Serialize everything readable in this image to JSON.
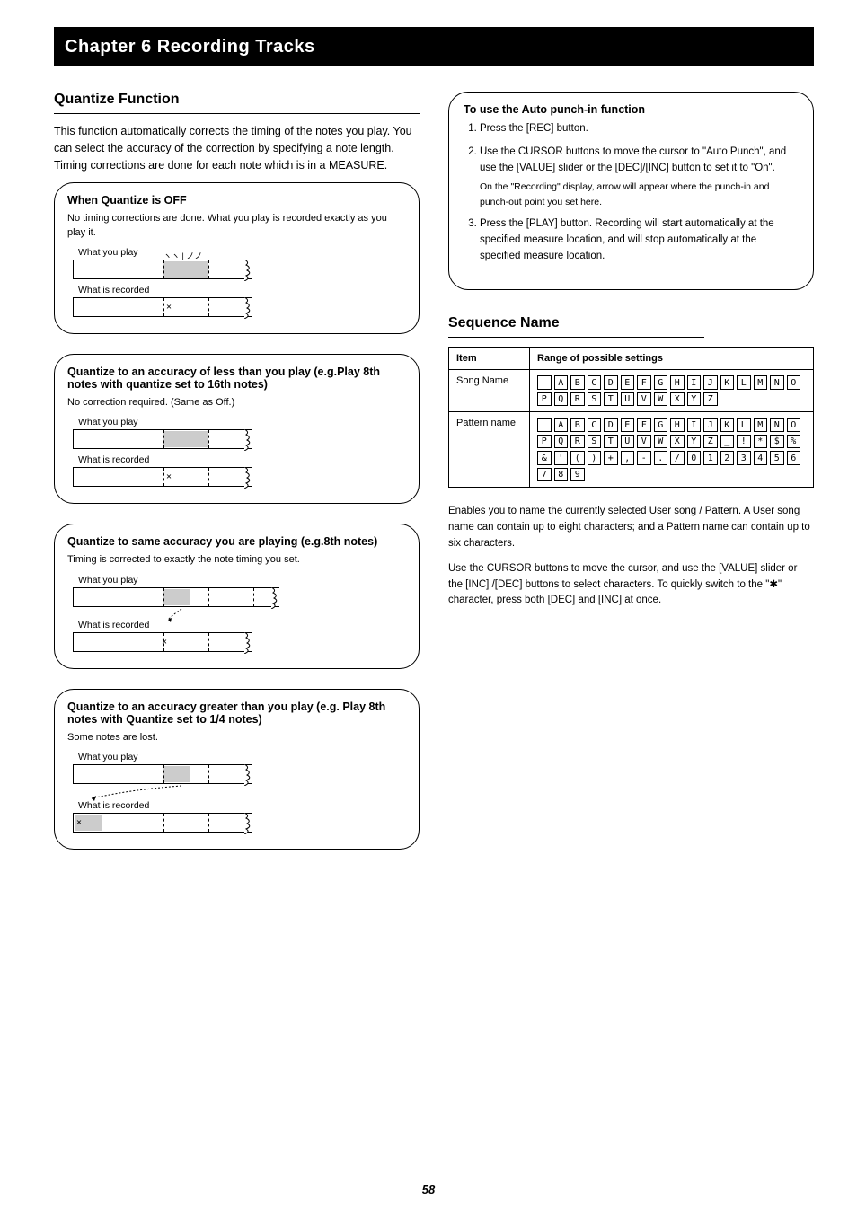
{
  "header": "Chapter 6 Recording Tracks",
  "left": {
    "quantize_title": "Quantize Function",
    "quantize_body": "This function automatically corrects the timing of the notes you play. You can select the accuracy of the correction by specifying a note length. Timing corrections are done for each note which is in a MEASURE.",
    "panels": {
      "off": {
        "title": "When Quantize is OFF",
        "desc": "No timing corrections are done. What you play is recorded exactly as you play it.",
        "row1": "What you play",
        "row2": "What is recorded"
      },
      "less": {
        "title": "Quantize to an accuracy of less than you play (e.g.Play 8th notes with quantize set to 16th notes)",
        "desc": "No correction required. (Same as Off.)",
        "row1": "What you play",
        "row2": "What is recorded"
      },
      "same": {
        "title": "Quantize to same accuracy you are playing (e.g.8th notes)",
        "desc": "Timing is corrected to exactly the note timing you set.",
        "row1": "What you play",
        "row2": "What is recorded"
      },
      "greater": {
        "title": "Quantize to an accuracy greater than you play (e.g. Play 8th notes with Quantize set to 1/4 notes)",
        "desc": "Some notes are lost.",
        "row1": "What you play",
        "row2": "What is recorded"
      }
    }
  },
  "right": {
    "autopunch": {
      "title": "To use the Auto punch-in function",
      "steps": [
        "Press the [REC] button.",
        {
          "text": "Use the CURSOR buttons to move the cursor to \"Auto Punch\", and use the [VALUE] slider or the [DEC]/[INC] button to set it to \"On\".",
          "sub": "On the \"Recording\" display, arrow will appear where the punch-in and punch-out point you set here."
        },
        "Press the [PLAY] button. Recording will start automatically at the specified measure location, and will stop automatically at the specified measure location."
      ]
    },
    "seq_name_title": "Sequence Name",
    "name_table": {
      "col1_header": "Item",
      "col2_header": "Range of possible settings",
      "row1_label": "Song Name",
      "row2_label": "Pattern name"
    },
    "chars_row1": "(space)ABCDEFGHIJKLMNOPQRSTUVWXYZ",
    "chars_row2": "(space)ABCDEFGHIJKLMNOPQRSTUVWXYZ_!*$%&'()+,-./0123456789",
    "seq_note1": "Enables you to name the currently selected User song / Pattern. A User song name can contain up to eight characters; and a Pattern name can contain up to six characters.",
    "seq_note2": "Use the CURSOR buttons to move the cursor, and use the [VALUE] slider or the [INC] /[DEC] buttons to select characters. To quickly switch to the \"✱\" character, press both [DEC] and [INC] at once."
  },
  "page_number": "58"
}
